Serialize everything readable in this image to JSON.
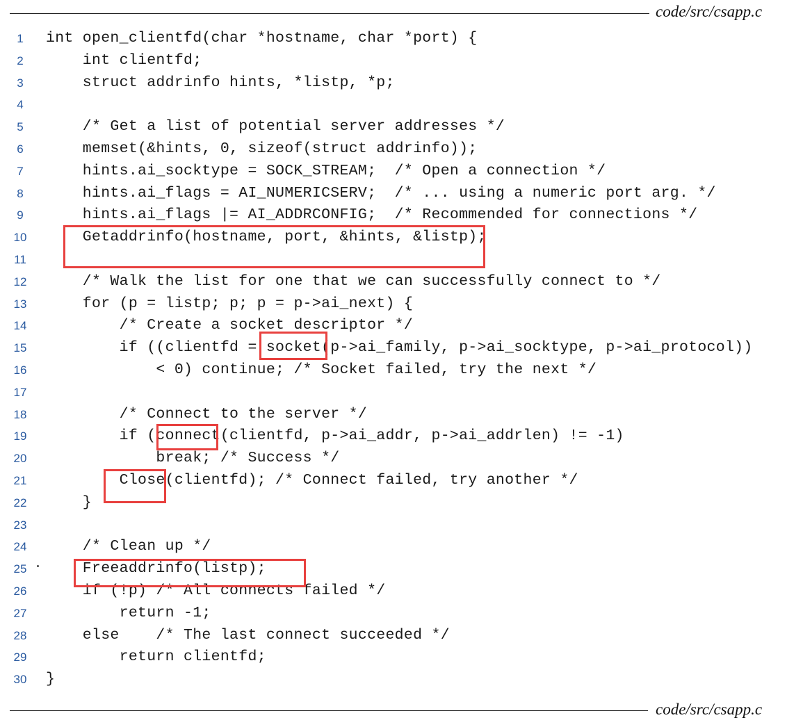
{
  "source_label_top": "code/src/csapp.c",
  "source_label_bottom": "code/src/csapp.c",
  "lines": [
    {
      "no": "1",
      "text": "int open_clientfd(char *hostname, char *port) {"
    },
    {
      "no": "2",
      "text": "    int clientfd;"
    },
    {
      "no": "3",
      "text": "    struct addrinfo hints, *listp, *p;"
    },
    {
      "no": "4",
      "text": ""
    },
    {
      "no": "5",
      "text": "    /* Get a list of potential server addresses */"
    },
    {
      "no": "6",
      "text": "    memset(&hints, 0, sizeof(struct addrinfo));"
    },
    {
      "no": "7",
      "text": "    hints.ai_socktype = SOCK_STREAM;  /* Open a connection */"
    },
    {
      "no": "8",
      "text": "    hints.ai_flags = AI_NUMERICSERV;  /* ... using a numeric port arg. */"
    },
    {
      "no": "9",
      "text": "    hints.ai_flags |= AI_ADDRCONFIG;  /* Recommended for connections */"
    },
    {
      "no": "10",
      "text": "    Getaddrinfo(hostname, port, &hints, &listp);"
    },
    {
      "no": "11",
      "text": ""
    },
    {
      "no": "12",
      "text": "    /* Walk the list for one that we can successfully connect to */"
    },
    {
      "no": "13",
      "text": "    for (p = listp; p; p = p->ai_next) {"
    },
    {
      "no": "14",
      "text": "        /* Create a socket descriptor */"
    },
    {
      "no": "15",
      "text": "        if ((clientfd = socket(p->ai_family, p->ai_socktype, p->ai_protocol))"
    },
    {
      "no": "16",
      "text": "            < 0) continue; /* Socket failed, try the next */"
    },
    {
      "no": "17",
      "text": ""
    },
    {
      "no": "18",
      "text": "        /* Connect to the server */"
    },
    {
      "no": "19",
      "text": "        if (connect(clientfd, p->ai_addr, p->ai_addrlen) != -1)"
    },
    {
      "no": "20",
      "text": "            break; /* Success */"
    },
    {
      "no": "21",
      "text": "        Close(clientfd); /* Connect failed, try another */"
    },
    {
      "no": "22",
      "text": "    }"
    },
    {
      "no": "23",
      "text": ""
    },
    {
      "no": "24",
      "text": "    /* Clean up */"
    },
    {
      "no": "25",
      "text": "    Freeaddrinfo(listp);"
    },
    {
      "no": "26",
      "text": "    if (!p) /* All connects failed */"
    },
    {
      "no": "27",
      "text": "        return -1;"
    },
    {
      "no": "28",
      "text": "    else    /* The last connect succeeded */"
    },
    {
      "no": "29",
      "text": "        return clientfd;"
    },
    {
      "no": "30",
      "text": "}"
    }
  ],
  "highlight_color": "#e8413f",
  "line_number_color": "#2a5aa0"
}
